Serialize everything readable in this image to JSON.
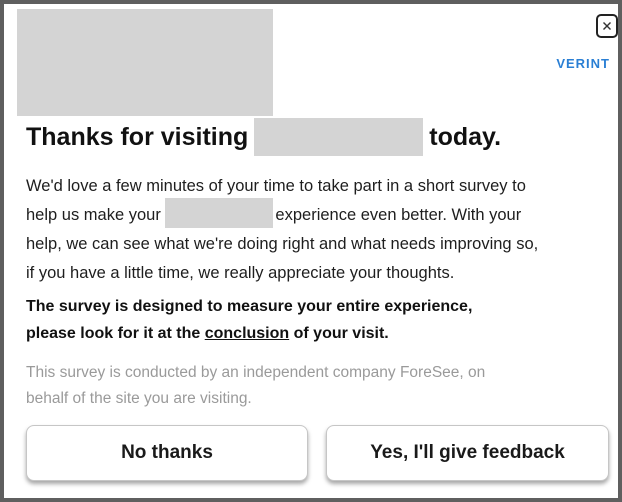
{
  "survey_dialog": {
    "brand": "VERINT",
    "close_icon": "close-icon",
    "headline_before": "Thanks for visiting",
    "headline_after": "today.",
    "body_line_1": "We'd love a few minutes of your time to take part in a short survey to",
    "body_line_2_before": "help us make your",
    "body_line_2_after": "experience even better. With your",
    "body_line_3": "help, we can see what we're doing right and what needs improving so,",
    "body_line_4": "if you have a little time, we really appreciate your thoughts.",
    "notice_line_1": "The survey is designed to measure your entire experience,",
    "notice_line_2_before": "please look for it at the",
    "notice_line_2_link": "conclusion",
    "notice_line_2_after": "of your visit.",
    "disclaimer_line_1": "This survey is conducted by an independent company ForeSee, on",
    "disclaimer_line_2": "behalf of the site you are visiting.",
    "decline_button": "No thanks",
    "accept_button": "Yes, I'll give feedback"
  },
  "colors": {
    "brand": "#2a7fd4",
    "border": "#5f5f5f",
    "redaction": "#d4d4d4",
    "disclaimer": "#9a9a9a"
  }
}
